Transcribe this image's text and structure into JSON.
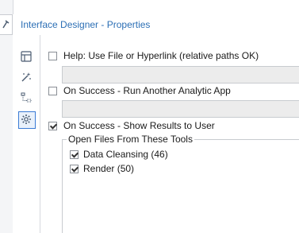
{
  "window": {
    "title": "Interface Designer - Properties"
  },
  "sidebar": {
    "icons": [
      "layout-icon",
      "wizard-icon",
      "tree-icon",
      "gear-icon"
    ],
    "active": "gear-icon"
  },
  "options": {
    "help": {
      "label": "Help: Use File or Hyperlink (relative paths OK)",
      "checked": false,
      "value": ""
    },
    "run_app": {
      "label": "On Success - Run Another Analytic App",
      "checked": false,
      "value": ""
    },
    "show_results": {
      "label": "On Success - Show Results to User",
      "checked": true
    }
  },
  "open_files": {
    "title": "Open Files From These Tools",
    "items": [
      {
        "label": "Data Cleansing (46)",
        "checked": true
      },
      {
        "label": "Render (50)",
        "checked": true
      }
    ]
  },
  "colors": {
    "accent": "#2c6fb5",
    "field_bg": "#ececec",
    "active_icon_border": "#3a7bd5"
  }
}
